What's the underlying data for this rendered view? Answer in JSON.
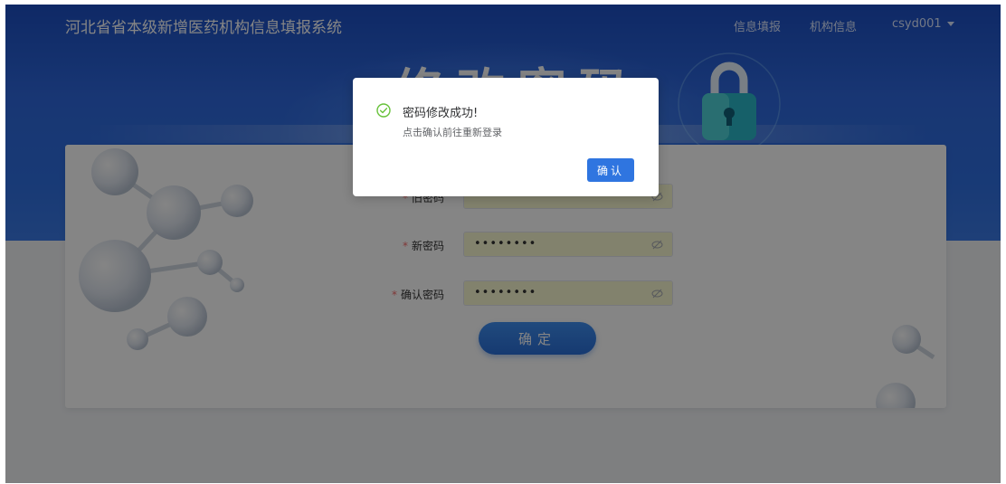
{
  "header": {
    "system_title": "河北省省本级新增医药机构信息填报系统",
    "nav": {
      "fill_label": "信息填报",
      "org_label": "机构信息",
      "user_label": "csyd001"
    }
  },
  "banner": {
    "title": "修改密码"
  },
  "form": {
    "old_password": {
      "label": "旧密码",
      "required_mark": "*",
      "value": "••••••••"
    },
    "new_password": {
      "label": "新密码",
      "required_mark": "*",
      "value": "••••••••"
    },
    "confirm_password": {
      "label": "确认密码",
      "required_mark": "*",
      "value": "••••••••"
    },
    "submit_label": "确定"
  },
  "dialog": {
    "title": "密码修改成功!",
    "message": "点击确认前往重新登录",
    "confirm_label": "确认"
  },
  "colors": {
    "primary": "#2f75e0",
    "success": "#67c23a",
    "required": "#f56c6c",
    "autofill_bg": "#fafad2"
  }
}
